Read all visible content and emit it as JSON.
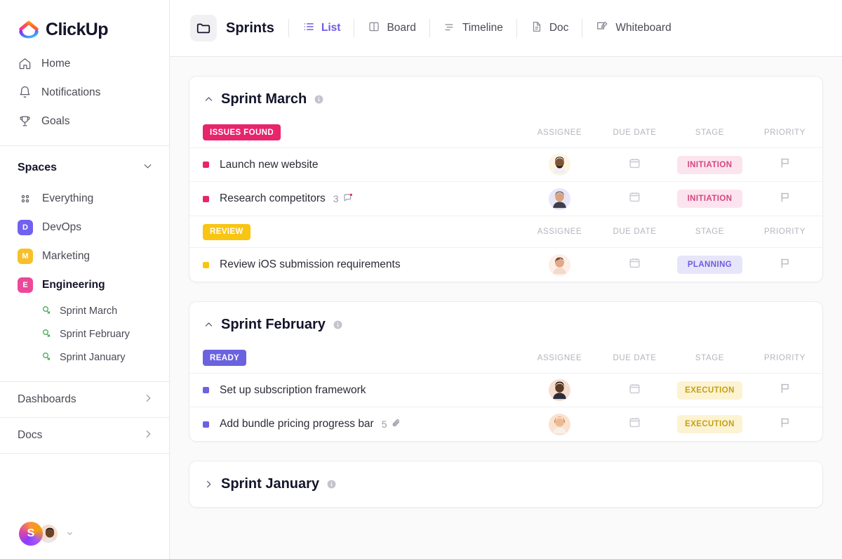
{
  "brand": {
    "name": "ClickUp",
    "accent": "#6e5ce0"
  },
  "sidebar": {
    "nav": [
      {
        "label": "Home",
        "icon": "home-icon"
      },
      {
        "label": "Notifications",
        "icon": "bell-icon"
      },
      {
        "label": "Goals",
        "icon": "trophy-icon"
      }
    ],
    "spaces_label": "Spaces",
    "everything_label": "Everything",
    "spaces": [
      {
        "label": "DevOps",
        "initial": "D",
        "color": "#7161f0",
        "active": false
      },
      {
        "label": "Marketing",
        "initial": "M",
        "color": "#f7c02a",
        "active": false
      },
      {
        "label": "Engineering",
        "initial": "E",
        "color": "#ec4899",
        "active": true
      }
    ],
    "sprints": [
      {
        "label": "Sprint  March"
      },
      {
        "label": "Sprint  February"
      },
      {
        "label": "Sprint January"
      }
    ],
    "bottom": [
      {
        "label": "Dashboards"
      },
      {
        "label": "Docs"
      }
    ],
    "workspace_initial": "S"
  },
  "topbar": {
    "title": "Sprints",
    "folder_icon": "folder-icon",
    "tabs": [
      {
        "label": "List",
        "icon": "list-icon",
        "active": true
      },
      {
        "label": "Board",
        "icon": "board-icon",
        "active": false
      },
      {
        "label": "Timeline",
        "icon": "timeline-icon",
        "active": false
      },
      {
        "label": "Doc",
        "icon": "doc-icon",
        "active": false
      },
      {
        "label": "Whiteboard",
        "icon": "whiteboard-icon",
        "active": false
      }
    ]
  },
  "columns": {
    "assignee": "ASSIGNEE",
    "due_date": "DUE DATE",
    "stage": "STAGE",
    "priority": "PRIORITY"
  },
  "sprints": [
    {
      "name": "Sprint March",
      "collapsed": false,
      "groups": [
        {
          "status": "ISSUES FOUND",
          "status_bg": "#e8246a",
          "tasks": [
            {
              "name": "Launch new website",
              "dot": "#e8246a",
              "meta": "",
              "meta_icon": "",
              "avatar_bg": "#fdf4e3",
              "avatar_skin": "#7d5437",
              "avatar_hair": "#2a1c12",
              "stage": "INITIATION",
              "stage_bg": "#fce4ee",
              "stage_fg": "#d4477f",
              "priority_icon": "flag-icon"
            },
            {
              "name": "Research competitors",
              "dot": "#e8246a",
              "meta": "3",
              "meta_icon": "comment-icon",
              "avatar_bg": "#e9e6f7",
              "avatar_skin": "#d8a380",
              "avatar_hair": "#4a3524",
              "stage": "INITIATION",
              "stage_bg": "#fce4ee",
              "stage_fg": "#d4477f",
              "priority_icon": "flag-icon"
            }
          ]
        },
        {
          "status": "REVIEW",
          "status_bg": "#f9c513",
          "tasks": [
            {
              "name": "Review iOS submission requirements",
              "dot": "#f9c513",
              "meta": "",
              "meta_icon": "",
              "avatar_bg": "#fdeee6",
              "avatar_skin": "#e0a888",
              "avatar_hair": "#7a4b32",
              "stage": "PLANNING",
              "stage_bg": "#e7e5f9",
              "stage_fg": "#6e5ce0",
              "priority_icon": "flag-icon"
            }
          ]
        }
      ]
    },
    {
      "name": "Sprint February",
      "collapsed": false,
      "groups": [
        {
          "status": "READY",
          "status_bg": "#6b62e0",
          "tasks": [
            {
              "name": "Set up subscription framework",
              "dot": "#6b62e0",
              "meta": "",
              "meta_icon": "",
              "avatar_bg": "#f4ddd0",
              "avatar_skin": "#5b3a23",
              "avatar_hair": "#1b1008",
              "stage": "EXECUTION",
              "stage_bg": "#fcf3d2",
              "stage_fg": "#c4a018",
              "priority_icon": "flag-icon"
            },
            {
              "name": "Add bundle pricing progress bar",
              "dot": "#6b62e0",
              "meta": "5",
              "meta_icon": "attachment-icon",
              "avatar_bg": "#fbe2cf",
              "avatar_skin": "#efb98f",
              "avatar_hair": "#b5763c",
              "stage": "EXECUTION",
              "stage_bg": "#fcf3d2",
              "stage_fg": "#c4a018",
              "priority_icon": "flag-icon"
            }
          ]
        }
      ]
    },
    {
      "name": "Sprint January",
      "collapsed": true,
      "groups": []
    }
  ]
}
